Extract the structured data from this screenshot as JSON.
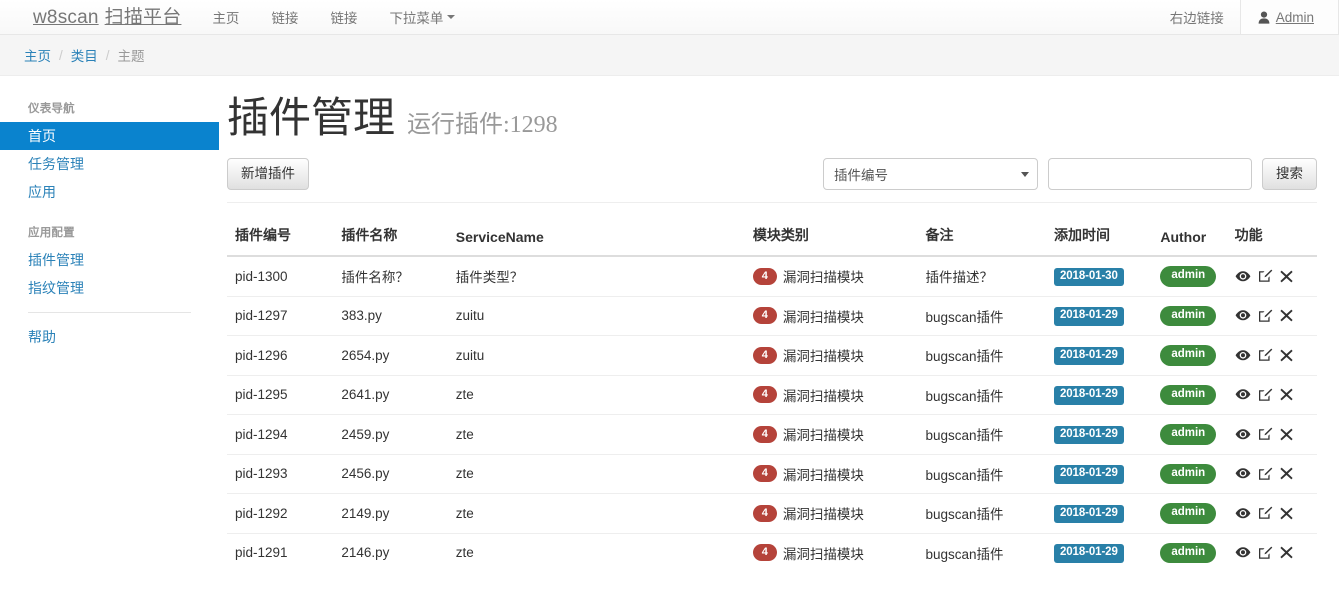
{
  "navbar": {
    "brand_main": "w8scan",
    "brand_sub": "扫描平台",
    "links": [
      {
        "label": "主页",
        "icon": "none"
      },
      {
        "label": "链接",
        "icon": "none"
      },
      {
        "label": "链接",
        "icon": "none"
      }
    ],
    "dropdown_label": "下拉菜单",
    "right_link": "右边链接",
    "user_label": "Admin",
    "user_icon": "user-icon"
  },
  "breadcrumb": {
    "items": [
      {
        "label": "主页",
        "link": true
      },
      {
        "label": "类目",
        "link": true
      },
      {
        "label": "主题",
        "link": false
      }
    ],
    "separator": "/"
  },
  "sidebar": {
    "groups": [
      {
        "heading": "仪表导航",
        "items": [
          {
            "label": "首页",
            "active": true
          },
          {
            "label": "任务管理",
            "active": false
          },
          {
            "label": "应用",
            "active": false
          }
        ]
      },
      {
        "heading": "应用配置",
        "items": [
          {
            "label": "插件管理",
            "active": false
          },
          {
            "label": "指纹管理",
            "active": false
          }
        ]
      }
    ],
    "help_label": "帮助"
  },
  "main": {
    "title": "插件管理",
    "subtitle": "运行插件:1298",
    "add_button": "新增插件",
    "search": {
      "select_value": "插件编号",
      "input_value": "",
      "input_placeholder": "",
      "button_label": "搜索"
    },
    "table": {
      "columns": [
        "插件编号",
        "插件名称",
        "ServiceName",
        "模块类别",
        "备注",
        "添加时间",
        "Author",
        "功能"
      ],
      "rows": [
        {
          "pid": "pid-1300",
          "name": "插件名称？",
          "service": "插件类型？",
          "module_count": "4",
          "module": "漏洞扫描模块",
          "remark": "插件描述？",
          "time": "2018-01-30",
          "author": "admin"
        },
        {
          "pid": "pid-1297",
          "name": "383.py",
          "service": "zuitu",
          "module_count": "4",
          "module": "漏洞扫描模块",
          "remark": "bugscan插件",
          "time": "2018-01-29",
          "author": "admin"
        },
        {
          "pid": "pid-1296",
          "name": "2654.py",
          "service": "zuitu",
          "module_count": "4",
          "module": "漏洞扫描模块",
          "remark": "bugscan插件",
          "time": "2018-01-29",
          "author": "admin"
        },
        {
          "pid": "pid-1295",
          "name": "2641.py",
          "service": "zte",
          "module_count": "4",
          "module": "漏洞扫描模块",
          "remark": "bugscan插件",
          "time": "2018-01-29",
          "author": "admin"
        },
        {
          "pid": "pid-1294",
          "name": "2459.py",
          "service": "zte",
          "module_count": "4",
          "module": "漏洞扫描模块",
          "remark": "bugscan插件",
          "time": "2018-01-29",
          "author": "admin"
        },
        {
          "pid": "pid-1293",
          "name": "2456.py",
          "service": "zte",
          "module_count": "4",
          "module": "漏洞扫描模块",
          "remark": "bugscan插件",
          "time": "2018-01-29",
          "author": "admin"
        },
        {
          "pid": "pid-1292",
          "name": "2149.py",
          "service": "zte",
          "module_count": "4",
          "module": "漏洞扫描模块",
          "remark": "bugscan插件",
          "time": "2018-01-29",
          "author": "admin"
        },
        {
          "pid": "pid-1291",
          "name": "2146.py",
          "service": "zte",
          "module_count": "4",
          "module": "漏洞扫描模块",
          "remark": "bugscan插件",
          "time": "2018-01-29",
          "author": "admin"
        }
      ],
      "action_icons": [
        "eye-icon",
        "edit-icon",
        "delete-icon"
      ]
    }
  },
  "colors": {
    "sidebar_active": "#0a83ce",
    "link": "#2b82b8",
    "badge_count": "#b5433a",
    "label_date": "#2980a8",
    "label_author": "#3d8b3d",
    "navbar_border": "#e7e7e7",
    "breadcrumb_bg": "#f5f5f5"
  }
}
